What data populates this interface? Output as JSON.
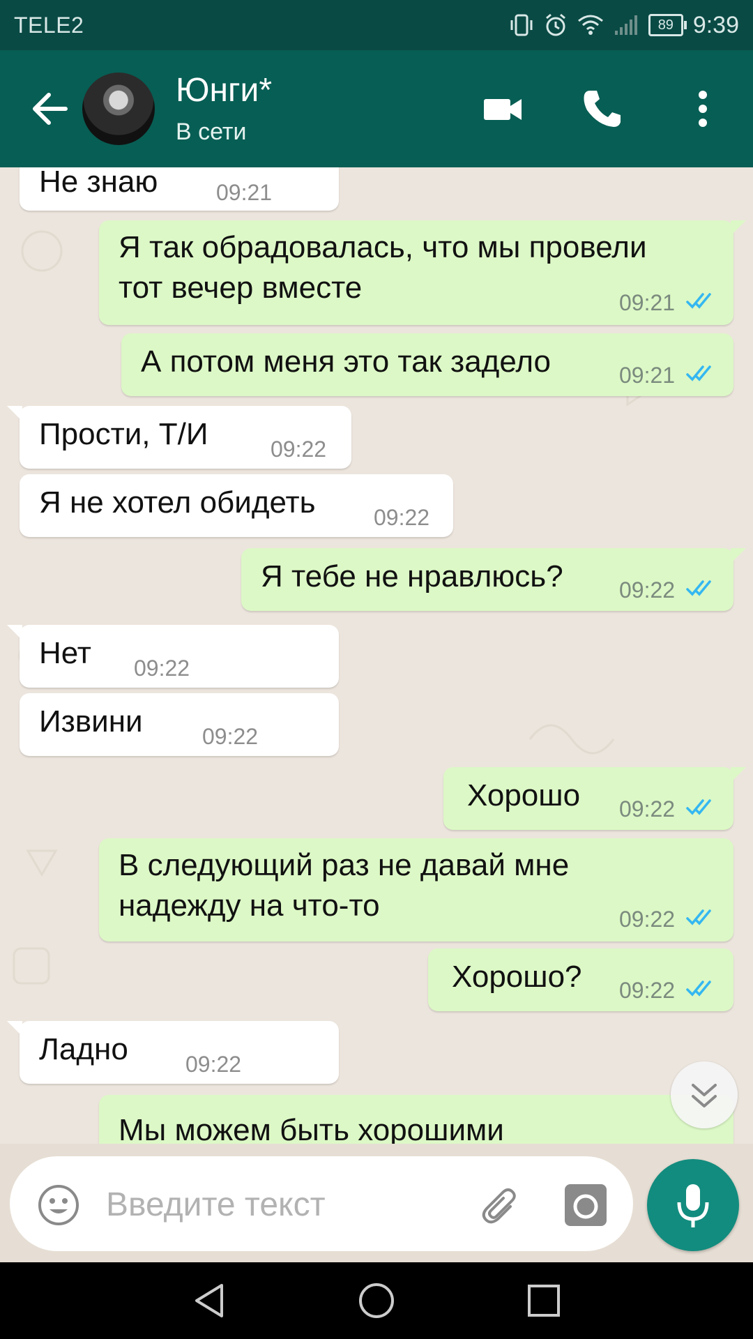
{
  "status_bar": {
    "carrier": "TELE2",
    "battery": "89",
    "time": "9:39"
  },
  "header": {
    "contact_name": "Юнги*",
    "contact_status": "В сети"
  },
  "messages": [
    {
      "direction": "in",
      "text": "Не знаю",
      "time": "09:21"
    },
    {
      "direction": "out",
      "text": "Я так обрадовалась, что мы провели\nтот вечер вместе",
      "time": "09:21",
      "read": true
    },
    {
      "direction": "out",
      "text": "А потом меня это так задело",
      "time": "09:21",
      "read": true
    },
    {
      "direction": "in",
      "text": "Прости, Т/И",
      "time": "09:22"
    },
    {
      "direction": "in",
      "text": "Я не хотел обидеть",
      "time": "09:22"
    },
    {
      "direction": "out",
      "text": "Я тебе не нравлюсь?",
      "time": "09:22",
      "read": true
    },
    {
      "direction": "in",
      "text": "Нет",
      "time": "09:22"
    },
    {
      "direction": "in",
      "text": "Извини",
      "time": "09:22"
    },
    {
      "direction": "out",
      "text": "Хорошо",
      "time": "09:22",
      "read": true
    },
    {
      "direction": "out",
      "text": "В следующий раз не давай мне\nнадежду на что-то",
      "time": "09:22",
      "read": true
    },
    {
      "direction": "out",
      "text": "Хорошо?",
      "time": "09:22",
      "read": true
    },
    {
      "direction": "in",
      "text": "Ладно",
      "time": "09:22"
    },
    {
      "direction": "out",
      "text": "Мы можем быть хорошими",
      "time": ""
    }
  ],
  "input": {
    "placeholder": "Введите текст",
    "value": ""
  },
  "colors": {
    "status_bar": "#0a4a45",
    "app_bar": "#075e54",
    "outgoing_bubble": "#dcf8c6",
    "incoming_bubble": "#ffffff",
    "read_ticks": "#34b7f1",
    "mic_button": "#128c7e"
  },
  "icons": {
    "back": "arrow-left-icon",
    "video_call": "videocam-icon",
    "voice_call": "phone-icon",
    "menu": "more-vert-icon",
    "emoji": "smiley-icon",
    "attach": "paperclip-icon",
    "camera": "camera-icon",
    "mic": "mic-icon",
    "scroll_down": "double-chevron-down-icon"
  }
}
